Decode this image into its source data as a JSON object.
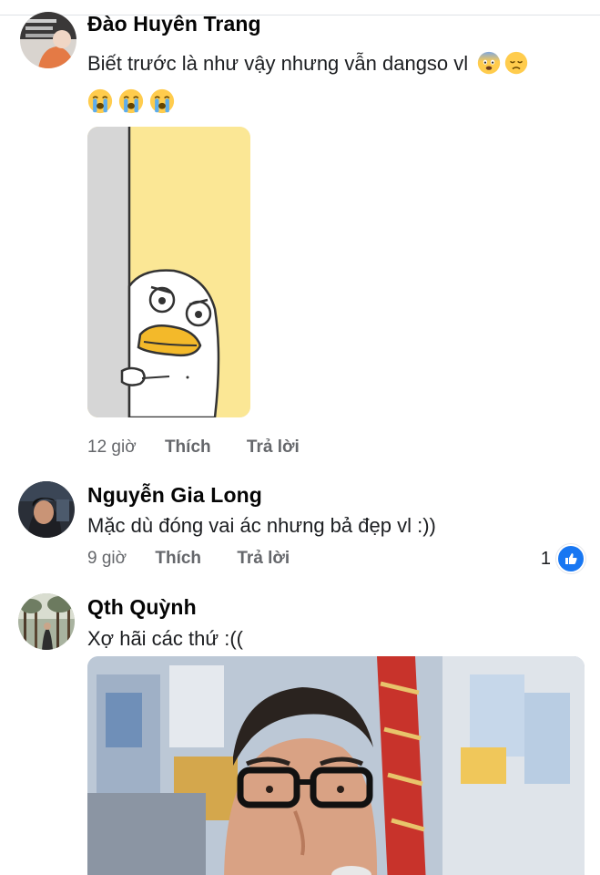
{
  "comments": [
    {
      "author": "Đào Huyên Trang",
      "text": "Biết trước là như vậy nhưng vẫn dangso vl",
      "inline_emojis": [
        "fearful-face-emoji",
        "disappointed-face-emoji"
      ],
      "emoji_row": [
        "loudly-crying-face-emoji",
        "loudly-crying-face-emoji",
        "loudly-crying-face-emoji"
      ],
      "attachment": "duck-peeking-sticker",
      "time": "12 giờ",
      "like_label": "Thích",
      "reply_label": "Trả lời"
    },
    {
      "author": "Nguyễn Gia Long",
      "text": "Mặc dù đóng vai ác nhưng bả đẹp vl :))",
      "time": "9 giờ",
      "like_label": "Thích",
      "reply_label": "Trả lời",
      "reaction_count": "1",
      "reaction_icon": "like-icon"
    },
    {
      "author": "Qth Quỳnh",
      "text": "Xợ hãi các thứ :((",
      "attachment": "man-with-glasses-photo"
    }
  ],
  "colors": {
    "meta_text": "#65676b",
    "like_blue": "#1877f2",
    "sticker_yellow": "#fbe795",
    "divider": "#dfe2e6"
  }
}
